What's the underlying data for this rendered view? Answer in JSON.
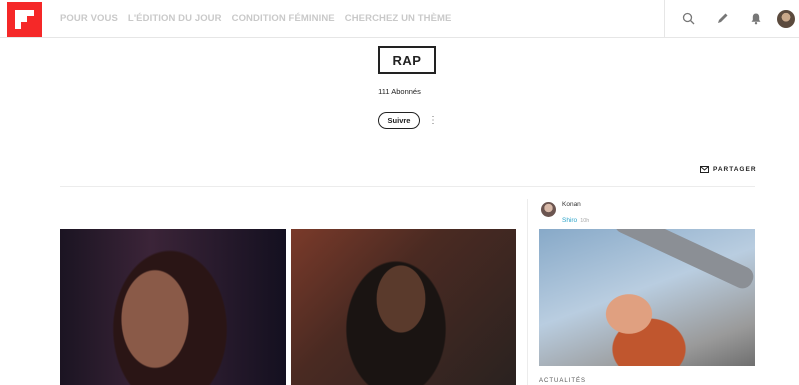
{
  "nav": {
    "items": [
      "POUR VOUS",
      "L'ÉDITION DU JOUR",
      "CONDITION FÉMININE",
      "CHERCHEZ UN THÈME"
    ]
  },
  "toolbar": {
    "icons": [
      "search-icon",
      "pencil-icon",
      "bell-icon",
      "avatar"
    ]
  },
  "topic": {
    "title": "RAP",
    "subscribers": "111 Abonnés",
    "follow_label": "Suivre",
    "more_icon": "⋮"
  },
  "share": {
    "label": "PARTAGER"
  },
  "sidebar": {
    "author_name": "Konan",
    "source": "Shiro",
    "age": "10h",
    "category": "ACTUALITÉS"
  },
  "colors": {
    "brand": "#f52828",
    "link": "#2aa3c9"
  }
}
